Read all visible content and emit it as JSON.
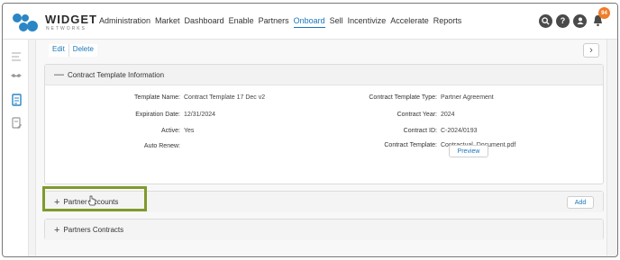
{
  "brand": {
    "name": "WIDGET",
    "subtitle": "NETWORKS"
  },
  "nav": {
    "items": [
      "Administration",
      "Market",
      "Dashboard",
      "Enable",
      "Partners",
      "Onboard",
      "Sell",
      "Incentivize",
      "Accelerate",
      "Reports"
    ],
    "active": "Onboard"
  },
  "header_icons": {
    "notification_count": "94"
  },
  "actions": {
    "edit": "Edit",
    "delete": "Delete"
  },
  "contract_section": {
    "title": "Contract Template Information",
    "left": [
      {
        "label": "Template Name:",
        "value": "Contract Template 17 Dec v2"
      },
      {
        "label": "Expiration Date:",
        "value": "12/31/2024"
      },
      {
        "label": "Active:",
        "value": "Yes"
      },
      {
        "label": "Auto Renew:",
        "value": ""
      }
    ],
    "right": [
      {
        "label": "Contract Template Type:",
        "value": "Partner Agreement"
      },
      {
        "label": "Contract Year:",
        "value": "2024"
      },
      {
        "label": "Contract ID:",
        "value": "C-2024/0193"
      },
      {
        "label": "Contract Template:",
        "value": "Contractual_Document.pdf"
      }
    ],
    "preview": "Preview"
  },
  "partner_accounts": {
    "title": "Partner Accounts",
    "add": "Add"
  },
  "partner_contracts": {
    "title": "Partners Contracts"
  },
  "colors": {
    "accent": "#1a76b8",
    "highlight": "#7f9a2c",
    "badge": "#f07d2a"
  }
}
